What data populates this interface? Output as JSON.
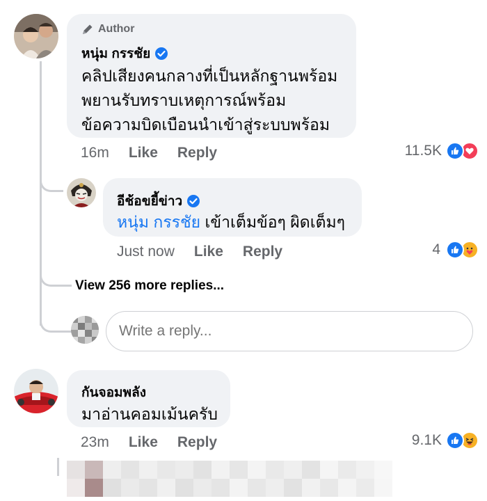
{
  "comment1": {
    "badge": "Author",
    "name": "หนุ่ม กรรชัย",
    "text_line1": "คลิปเสียงคนกลางที่เป็นหลักฐานพร้อม",
    "text_line2": "พยานรับทราบเหตุการณ์พร้อม",
    "text_line3": "ข้อความบิดเบือนนำเข้าสู่ระบบพร้อม",
    "time": "16m",
    "like_label": "Like",
    "reply_label": "Reply",
    "reaction_count": "11.5K"
  },
  "reply1": {
    "name": "อีช้อขยี้ข่าว",
    "mention": "หนุ่ม กรรชัย",
    "text": " เข้าเต็มข้อๆ ผิดเต็มๆ",
    "time": "Just now",
    "like_label": "Like",
    "reply_label": "Reply",
    "reaction_count": "4"
  },
  "view_more": "View 256 more replies...",
  "reply_input": {
    "placeholder": "Write a reply..."
  },
  "comment2": {
    "name": "กันจอมพลัง",
    "text": "มาอ่านคอมเม้นครับ",
    "time": "23m",
    "like_label": "Like",
    "reply_label": "Reply",
    "reaction_count": "9.1K"
  },
  "colors": {
    "accent": "#1877f2",
    "bubble": "#f0f2f5",
    "meta": "#65676b"
  }
}
